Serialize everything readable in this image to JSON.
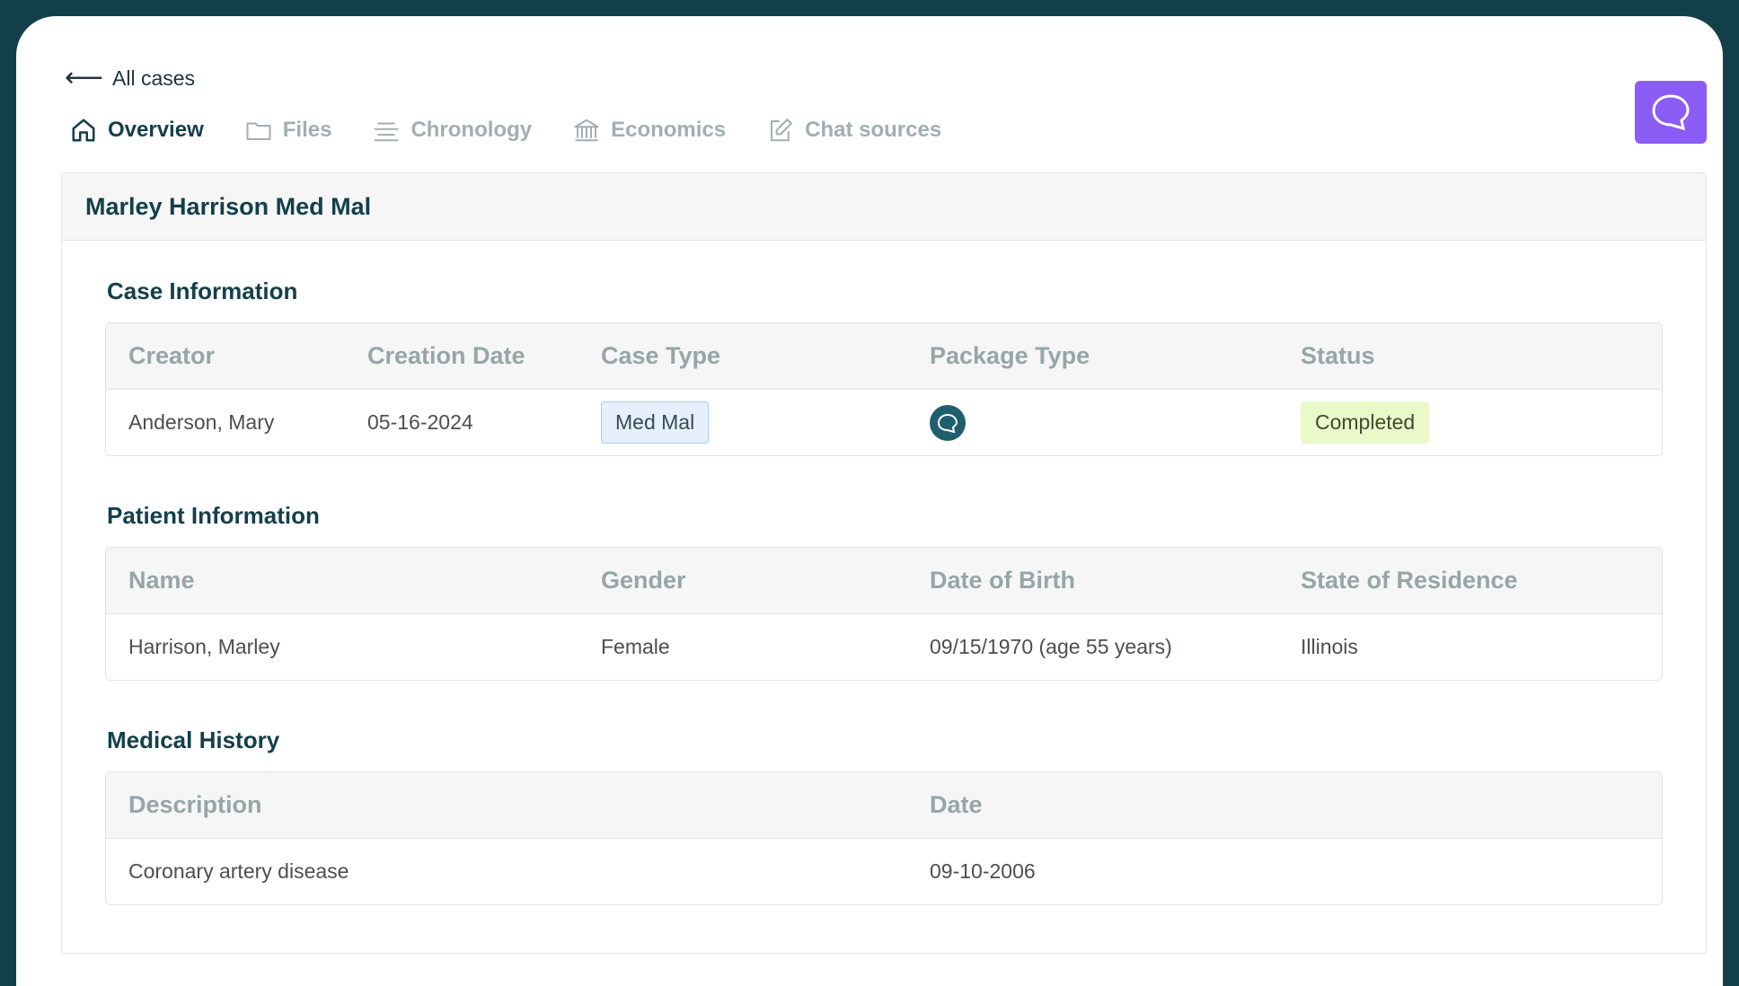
{
  "nav": {
    "back_label": "All cases",
    "tabs": [
      {
        "label": "Overview",
        "icon": "home-icon",
        "active": true
      },
      {
        "label": "Files",
        "icon": "folder-icon",
        "active": false
      },
      {
        "label": "Chronology",
        "icon": "list-lines-icon",
        "active": false
      },
      {
        "label": "Economics",
        "icon": "bank-icon",
        "active": false
      },
      {
        "label": "Chat sources",
        "icon": "edit-square-icon",
        "active": false
      }
    ]
  },
  "card": {
    "title": "Marley Harrison Med Mal"
  },
  "case_info": {
    "title": "Case Information",
    "headers": {
      "creator": "Creator",
      "creation_date": "Creation Date",
      "case_type": "Case Type",
      "package_type": "Package Type",
      "status": "Status"
    },
    "row": {
      "creator": "Anderson, Mary",
      "creation_date": "05-16-2024",
      "case_type": "Med Mal",
      "package_type_icon": "chat-bubble-icon",
      "status": "Completed"
    }
  },
  "patient_info": {
    "title": "Patient Information",
    "headers": {
      "name": "Name",
      "gender": "Gender",
      "dob": "Date of Birth",
      "state": "State of Residence"
    },
    "row": {
      "name": "Harrison, Marley",
      "gender": "Female",
      "dob": "09/15/1970 (age 55 years)",
      "state": "Illinois"
    }
  },
  "medical_history": {
    "title": "Medical History",
    "headers": {
      "description": "Description",
      "date": "Date"
    },
    "rows": [
      {
        "description": "Coronary artery disease",
        "date": "09-10-2006"
      }
    ]
  },
  "colors": {
    "brand_dark": "#133f4a",
    "chat_accent": "#8b5cf6",
    "tag_blue_bg": "#e5f0fc",
    "tag_green_bg": "#e9f9c8"
  }
}
